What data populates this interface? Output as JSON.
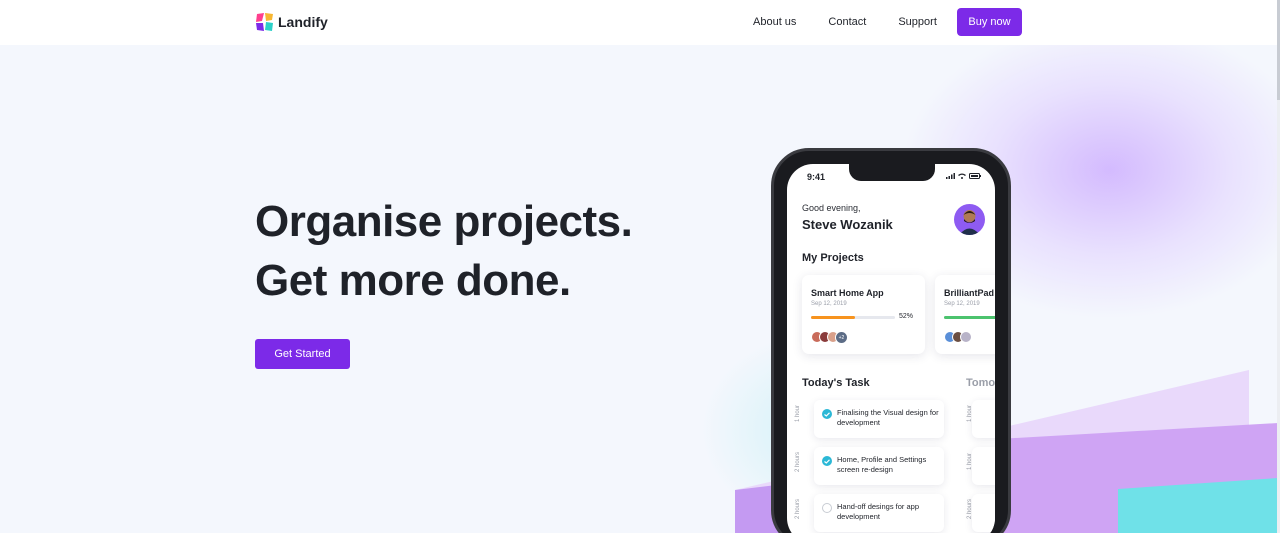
{
  "brand": {
    "name": "Landify"
  },
  "nav": {
    "links": [
      "About us",
      "Contact",
      "Support"
    ],
    "buy_label": "Buy now"
  },
  "hero": {
    "headline_line1": "Organise projects.",
    "headline_line2": "Get more done.",
    "cta_label": "Get Started"
  },
  "phone": {
    "time": "9:41",
    "greeting": "Good evening,",
    "user_name": "Steve Wozanik",
    "projects_title": "My Projects",
    "projects": [
      {
        "title": "Smart Home App",
        "date": "Sep 12, 2019",
        "progress_percent": 52,
        "progress_label": "52%",
        "extra_members": "+2",
        "bar_color": "#f7931e"
      },
      {
        "title": "BrilliantPad A",
        "date": "Sep 12, 2019",
        "progress_percent": 80,
        "bar_color": "#4cc36e"
      }
    ],
    "today_title": "Today's Task",
    "tomorrow_title": "Tomor",
    "tasks": [
      {
        "text": "Finalising the Visual design for development",
        "hours": "1 hour",
        "done": true
      },
      {
        "text": "Home, Profile and Settings screen re-design",
        "hours": "2 hours",
        "done": true
      },
      {
        "text": "Hand-off desings for app development",
        "hours": "2 hours",
        "done": false
      }
    ],
    "tomorrow_hours": [
      "1 hour",
      "1 hour",
      "2 hours"
    ]
  },
  "colors": {
    "accent": "#7c2ae8",
    "check": "#2bb8d6",
    "stripe_light": "#e7d4fb",
    "stripe_mid": "#c79ef5",
    "stripe_teal": "#6ee0e8"
  }
}
